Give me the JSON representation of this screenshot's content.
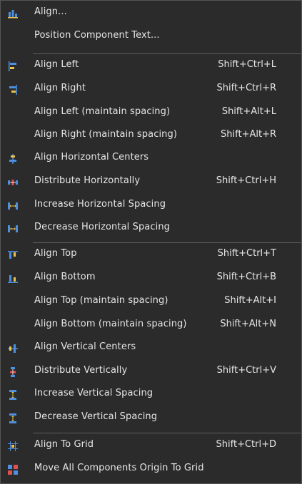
{
  "menu": {
    "items": [
      {
        "name": "align-dialog",
        "label": "Align...",
        "shortcut": "",
        "icon": "align-bars-icon"
      },
      {
        "name": "position-component-text",
        "label": "Position Component Text...",
        "shortcut": "",
        "icon": ""
      },
      {
        "name": "align-left",
        "label": "Align Left",
        "shortcut": "Shift+Ctrl+L",
        "icon": "align-left-icon"
      },
      {
        "name": "align-right",
        "label": "Align Right",
        "shortcut": "Shift+Ctrl+R",
        "icon": "align-right-icon"
      },
      {
        "name": "align-left-maintain-spacing",
        "label": "Align Left (maintain spacing)",
        "shortcut": "Shift+Alt+L",
        "icon": ""
      },
      {
        "name": "align-right-maintain-spacing",
        "label": "Align Right (maintain spacing)",
        "shortcut": "Shift+Alt+R",
        "icon": ""
      },
      {
        "name": "align-horizontal-centers",
        "label": "Align Horizontal Centers",
        "shortcut": "",
        "icon": "align-horizontal-centers-icon"
      },
      {
        "name": "distribute-horizontally",
        "label": "Distribute Horizontally",
        "shortcut": "Shift+Ctrl+H",
        "icon": "distribute-horizontally-icon"
      },
      {
        "name": "increase-horizontal-spacing",
        "label": "Increase Horizontal Spacing",
        "shortcut": "",
        "icon": "increase-horizontal-spacing-icon"
      },
      {
        "name": "decrease-horizontal-spacing",
        "label": "Decrease Horizontal Spacing",
        "shortcut": "",
        "icon": "decrease-horizontal-spacing-icon"
      },
      {
        "name": "align-top",
        "label": "Align Top",
        "shortcut": "Shift+Ctrl+T",
        "icon": "align-top-icon"
      },
      {
        "name": "align-bottom",
        "label": "Align Bottom",
        "shortcut": "Shift+Ctrl+B",
        "icon": "align-bottom-icon"
      },
      {
        "name": "align-top-maintain-spacing",
        "label": "Align Top (maintain spacing)",
        "shortcut": "Shift+Alt+I",
        "icon": ""
      },
      {
        "name": "align-bottom-maintain-spacing",
        "label": "Align Bottom (maintain spacing)",
        "shortcut": "Shift+Alt+N",
        "icon": ""
      },
      {
        "name": "align-vertical-centers",
        "label": "Align Vertical Centers",
        "shortcut": "",
        "icon": "align-vertical-centers-icon"
      },
      {
        "name": "distribute-vertically",
        "label": "Distribute Vertically",
        "shortcut": "Shift+Ctrl+V",
        "icon": "distribute-vertically-icon"
      },
      {
        "name": "increase-vertical-spacing",
        "label": "Increase Vertical Spacing",
        "shortcut": "",
        "icon": "increase-vertical-spacing-icon"
      },
      {
        "name": "decrease-vertical-spacing",
        "label": "Decrease Vertical Spacing",
        "shortcut": "",
        "icon": "decrease-vertical-spacing-icon"
      },
      {
        "name": "align-to-grid",
        "label": "Align To Grid",
        "shortcut": "Shift+Ctrl+D",
        "icon": "align-to-grid-icon"
      },
      {
        "name": "move-origin-to-grid",
        "label": "Move All Components Origin To Grid",
        "shortcut": "",
        "icon": "move-origin-to-grid-icon"
      }
    ]
  },
  "colors": {
    "background": "#2b2b2b",
    "text": "#e6e6e6",
    "separator": "#5d5d5d",
    "icon_blue": "#4d8fe0",
    "icon_yellow": "#e8c24a",
    "icon_red": "#e05050"
  }
}
